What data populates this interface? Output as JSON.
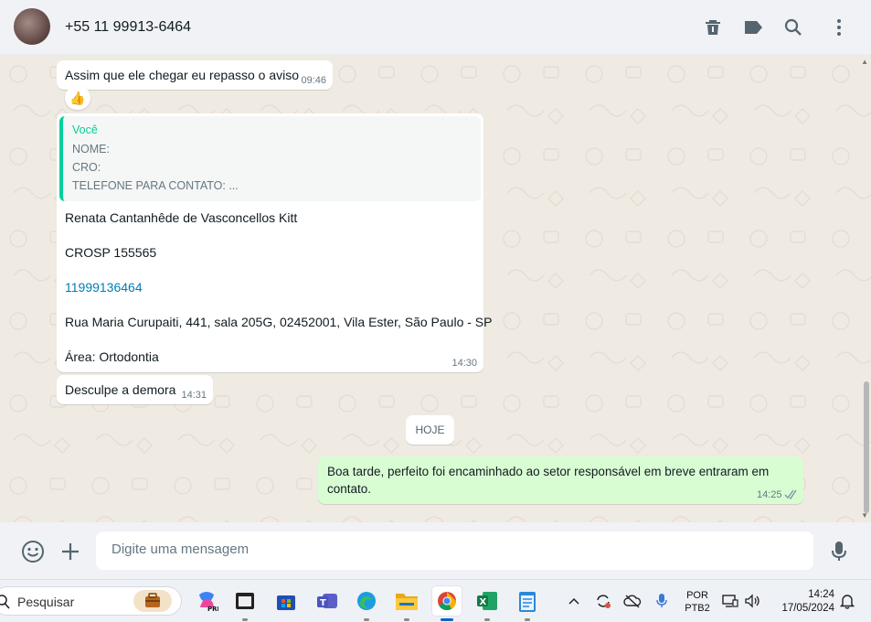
{
  "header": {
    "contact_name": "+55 11 99913-6464",
    "icons": [
      "delete-icon",
      "label-icon",
      "search-icon",
      "menu-icon"
    ]
  },
  "messages": [
    {
      "direction": "in",
      "text": "Assim que ele chegar eu repasso o aviso",
      "time": "09:46",
      "reaction": "👍"
    },
    {
      "direction": "in",
      "quote": {
        "author": "Você",
        "lines": [
          "NOME:",
          "CRO:",
          "TELEFONE PARA CONTATO: ..."
        ]
      },
      "lines": [
        "Renata Cantanhêde de Vasconcellos Kitt",
        "CROSP 155565",
        "11999136464",
        "Rua Maria Curupaiti, 441, sala 205G, 02452001, Vila Ester, São Paulo - SP",
        "Área: Ortodontia"
      ],
      "time": "14:30"
    },
    {
      "direction": "in",
      "text": "Desculpe a demora",
      "time": "14:31"
    },
    {
      "direction": "out",
      "text": "Boa tarde, perfeito foi encaminhado ao setor responsável em breve entraram em contato.",
      "time": "14:25",
      "status": "read"
    }
  ],
  "date_divider": "HOJE",
  "compose": {
    "placeholder": "Digite uma mensagem"
  },
  "taskbar": {
    "search_label": "Pesquisar",
    "apps": [
      "work-app",
      "copilot-pre",
      "app-window",
      "microsoft-store",
      "teams",
      "edge",
      "file-explorer",
      "chrome",
      "excel",
      "notepad"
    ],
    "language": [
      "POR",
      "PTB2"
    ],
    "time": "14:24",
    "date": "17/05/2024"
  },
  "colors": {
    "chat_bg": "#efeae2",
    "outgoing_bubble": "#d9fdd3",
    "accent": "#06cf9c",
    "link": "#027eb5",
    "read_ticks": "#53bdeb"
  }
}
